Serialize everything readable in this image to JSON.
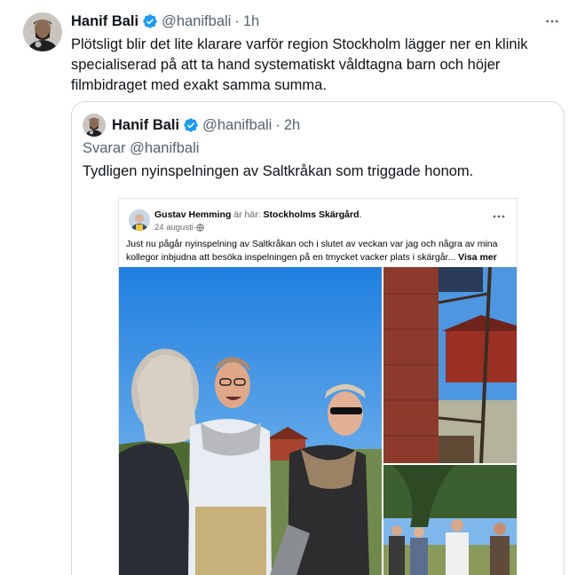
{
  "tweet": {
    "author_name": "Hanif Bali",
    "author_handle": "@hanifbali",
    "separator": "·",
    "time": "1h",
    "text": "Plötsligt blir det lite klarare varför region Stockholm lägger ner en klinik specialiserad på att ta hand systematiskt våldtagna barn och höjer filmbidraget med exakt samma summa."
  },
  "quoted": {
    "author_name": "Hanif Bali",
    "author_handle": "@hanifbali",
    "separator": "·",
    "time": "2h",
    "replying_to": "Svarar @hanifbali",
    "text": "Tydligen nyinspelningen av Saltkråkan som triggade honom."
  },
  "facebook_post": {
    "author": "Gustav Hemming",
    "location_prefix": " är här: ",
    "location": "Stockholms Skärgård",
    "location_suffix": ".",
    "date": "24 augusti",
    "date_separator": " · ",
    "text": "Just nu pågår nyinspelning av Saltkråkan och i slutet av veckan var jag och några av mina kollegor inbjudna att besöka inspelningen på en tmycket vacker plats i skärgår...",
    "see_more": " Visa mer"
  },
  "colors": {
    "verified": "#1d9bf0",
    "text_primary": "#0f1419",
    "text_secondary": "#536471",
    "border": "#cfd9de"
  },
  "icons": {
    "verified": "verified-badge-icon",
    "more": "more-horizontal-icon",
    "globe": "globe-icon"
  }
}
